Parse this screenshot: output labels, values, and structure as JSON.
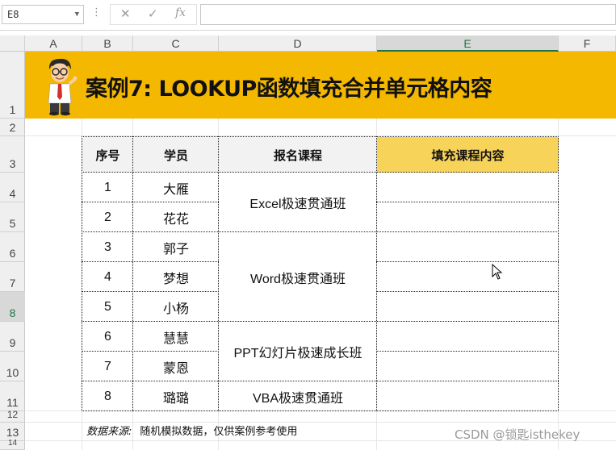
{
  "formula_bar": {
    "name_box": "E8",
    "cancel_icon": "✕",
    "enter_icon": "✓",
    "fx_label": "fx",
    "formula": ""
  },
  "columns": [
    "A",
    "B",
    "C",
    "D",
    "E",
    "F"
  ],
  "rows": [
    "1",
    "2",
    "3",
    "4",
    "5",
    "6",
    "7",
    "8",
    "9",
    "10",
    "11",
    "12",
    "13",
    "14"
  ],
  "banner": {
    "title": "案例7: LOOKUP函数填充合并单元格内容",
    "bg_color": "#f4b800",
    "mascot_icon": "cartoon-man-thumbs-up"
  },
  "table": {
    "headers": [
      "序号",
      "学员",
      "报名课程",
      "填充课程内容"
    ],
    "numbers": [
      "1",
      "2",
      "3",
      "4",
      "5",
      "6",
      "7",
      "8"
    ],
    "students": [
      "大雁",
      "花花",
      "郭子",
      "梦想",
      "小杨",
      "慧慧",
      "蒙恩",
      "璐璐"
    ],
    "courses": [
      "Excel极速贯通班",
      "Word极速贯通班",
      "PPT幻灯片极速成长班",
      "VBA极速贯通班"
    ],
    "fill_header_color": "#f7d35a"
  },
  "footnote": {
    "label": "数据来源:",
    "text": "随机模拟数据，仅供案例参考使用"
  },
  "watermark": "CSDN @锁匙isthekey"
}
